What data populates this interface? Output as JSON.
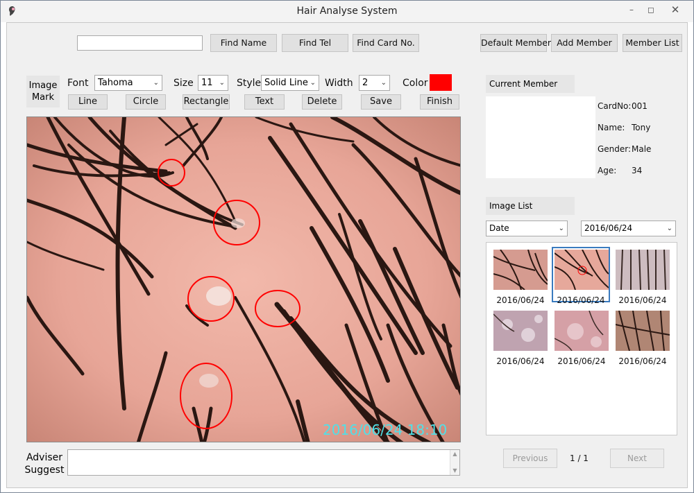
{
  "window": {
    "title": "Hair Analyse System"
  },
  "search": {
    "value": "",
    "find_name": "Find Name",
    "find_tel": "Find Tel",
    "find_card": "Find Card No.",
    "default_member": "Default Member",
    "add_member": "Add Member",
    "member_list": "Member List"
  },
  "mark": {
    "image_mark_1": "Image",
    "image_mark_2": "Mark",
    "font_label": "Font",
    "font_value": "Tahoma",
    "size_label": "Size",
    "size_value": "11",
    "style_label": "Style",
    "style_value": "Solid Line",
    "width_label": "Width",
    "width_value": "2",
    "color_label": "Color",
    "color_value": "#ff0000",
    "tools": {
      "line": "Line",
      "circle": "Circle",
      "rectangle": "Rectangle",
      "text": "Text",
      "delete": "Delete",
      "save": "Save",
      "finish": "Finish"
    }
  },
  "image": {
    "timestamp": "2016/06/24 18:10"
  },
  "adviser": {
    "label_1": "Adviser",
    "label_2": "Suggest",
    "value": ""
  },
  "member": {
    "header": "Current Member",
    "card_label": "CardNo:",
    "card_value": "001",
    "name_label": "Name:",
    "name_value": "Tony",
    "gender_label": "Gender:",
    "gender_value": "Male",
    "age_label": "Age:",
    "age_value": "34"
  },
  "image_list": {
    "header": "Image List",
    "filter_value": "Date",
    "date_value": "2016/06/24",
    "thumbs": [
      {
        "caption": "2016/06/24",
        "selected": false
      },
      {
        "caption": "2016/06/24",
        "selected": true
      },
      {
        "caption": "2016/06/24",
        "selected": false
      },
      {
        "caption": "2016/06/24",
        "selected": false
      },
      {
        "caption": "2016/06/24",
        "selected": false
      },
      {
        "caption": "2016/06/24",
        "selected": false
      }
    ],
    "previous": "Previous",
    "page": "1 / 1",
    "next": "Next"
  }
}
